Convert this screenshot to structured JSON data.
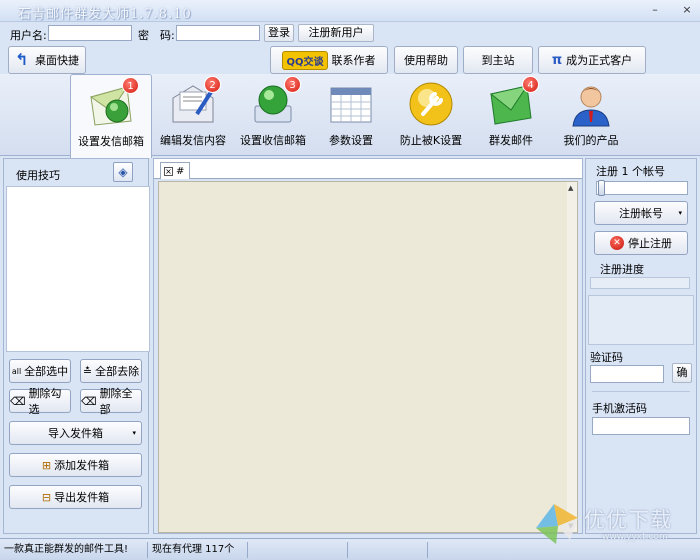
{
  "window": {
    "title": "石青邮件群发大师1.7.8.10",
    "minimize": "–",
    "close": "×"
  },
  "login": {
    "username_label": "用户名:",
    "password_label": "密　码:",
    "login_button": "登录",
    "register_button": "注册新用户"
  },
  "toolbar": {
    "desktop_shortcut": "桌面快捷",
    "qq_badge": "QQ交谈",
    "contact_author": "联系作者",
    "help": "使用帮助",
    "home": "到主站",
    "pi_glyph": "π",
    "formal_customer": "成为正式客户"
  },
  "nav": {
    "tabs": [
      {
        "label": "设置发信邮箱",
        "badge": "1",
        "icon": "envelope-globe-icon"
      },
      {
        "label": "编辑发信内容",
        "badge": "2",
        "icon": "letter-edit-icon"
      },
      {
        "label": "设置收信邮箱",
        "badge": "3",
        "icon": "inbox-globe-icon"
      },
      {
        "label": "参数设置",
        "badge": "",
        "icon": "calendar-grid-icon"
      },
      {
        "label": "防止被K设置",
        "badge": "",
        "icon": "wrench-icon"
      },
      {
        "label": "群发邮件",
        "badge": "4",
        "icon": "green-envelope-icon"
      },
      {
        "label": "我们的产品",
        "badge": "",
        "icon": "person-icon"
      }
    ]
  },
  "left": {
    "tips_title": "使用技巧",
    "select_all": "全部选中",
    "remove_all": "全部去除",
    "delete_checked": "删除勾选",
    "delete_all": "删除全部",
    "import_outbox": "导入发件箱",
    "add_outbox": "添加发件箱",
    "export_outbox": "导出发件箱",
    "all_glyph": "all"
  },
  "middle": {
    "tab_label": "#"
  },
  "right": {
    "register_count": "注册 1 个帐号",
    "register_account": "注册帐号",
    "stop_register": "停止注册",
    "register_progress": "注册进度",
    "captcha_label": "验证码",
    "confirm_button": "确",
    "phone_label": "手机激活码"
  },
  "status": {
    "slogan": "一款真正能群发的邮件工具!",
    "proxy": "现在有代理 117个"
  },
  "watermark": {
    "brand": "优优下载",
    "url": "www.yyxt.com"
  },
  "colors": {
    "background": "#d9e4f5",
    "badge_red": "#d41a10",
    "accent_blue": "#2a5cc4"
  }
}
